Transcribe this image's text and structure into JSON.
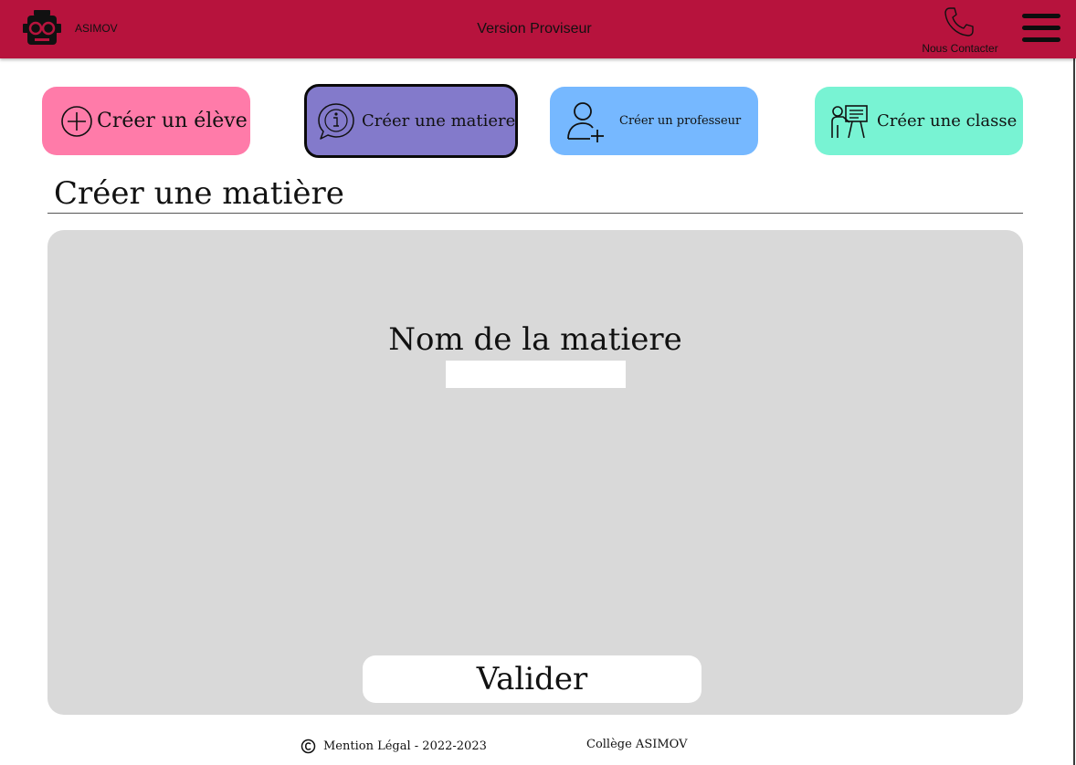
{
  "colors": {
    "header": "#b7133d",
    "btn_eleve": "#ff7ba9",
    "btn_matiere": "#837acb",
    "btn_prof": "#76b8ff",
    "btn_classe": "#78f3d3",
    "panel": "#d9d9d9"
  },
  "header": {
    "brand": "ASIMOV",
    "title": "Version Proviseur",
    "contact_label": "Nous Contacter",
    "logo_icon": "robot-glasses-logo",
    "contact_icon": "phone-icon",
    "menu_icon": "hamburger-menu-icon"
  },
  "actions": [
    {
      "label": "Créer un élève",
      "icon": "plus-circle-icon"
    },
    {
      "label": "Créer une matiere",
      "icon": "info-bubble-icon"
    },
    {
      "label": "Créer un professeur",
      "icon": "user-plus-icon"
    },
    {
      "label": "Créer une classe",
      "icon": "teacher-board-icon"
    }
  ],
  "section": {
    "title": "Créer une matière"
  },
  "form": {
    "field_label": "Nom de la matiere",
    "field_value": "",
    "submit_label": "Valider"
  },
  "footer": {
    "copyright_icon": "copyright-icon",
    "mention": "Mention Légal - 2022-2023",
    "school": "Collège ASIMOV"
  }
}
